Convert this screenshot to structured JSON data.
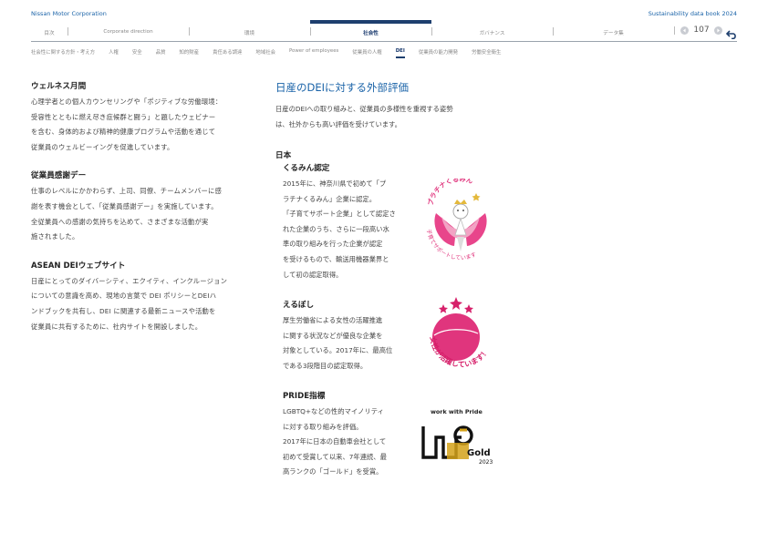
{
  "header": {
    "company": "Nissan Motor Corporation",
    "book": "Sustainability data book 2024"
  },
  "nav": {
    "tabs": [
      "目次",
      "Corporate direction",
      "環境",
      "社会性",
      "ガバナンス",
      "データ集"
    ],
    "active_index": 3,
    "page": "107"
  },
  "subnav": {
    "items": [
      "社会性に関する方針・考え方",
      "人権",
      "安全",
      "品質",
      "知的財産",
      "責任ある調達",
      "地域社会",
      "Power of employees",
      "従業員の人権",
      "DEI",
      "従業員の能力開発",
      "労働安全衛生"
    ],
    "active_index": 9
  },
  "left": {
    "sections": [
      {
        "title": "ウェルネス月間",
        "lines": [
          "心理学者との個人カウンセリングや「ポジティブな労働環境：",
          "受容性とともに燃え尽き症候群と闘う」と題したウェビナー",
          "を含む、身体的および精神的健康プログラムや活動を通じて",
          "従業員のウェルビーイングを促進しています。"
        ]
      },
      {
        "title": "従業員感謝デー",
        "lines": [
          "仕事のレベルにかかわらず、上司、同僚、チームメンバーに感",
          "謝を表す機会として、「従業員感謝デー」を実施しています。",
          "全従業員への感謝の気持ちを込めて、さまざまな活動が実",
          "施されました。"
        ]
      },
      {
        "title": "ASEAN DEIウェブサイト",
        "lines": [
          "日産にとってのダイバーシティ、エクイティ、インクルージョン",
          "についての意識を高め、現地の言葉で DEI ポリシーとDEIハ",
          "ンドブックを共有し、DEI に関連する最新ニュースや活動を",
          "従業員に共有するために、社内サイトを開設しました。"
        ]
      }
    ]
  },
  "right": {
    "title": "日産のDEIに対する外部評価",
    "intro_lines": [
      "日産のDEIへの取り組みと、従業員の多様性を重視する姿勢",
      "は、社外からも高い評価を受けています。"
    ],
    "region": "日本",
    "awards": [
      {
        "title": "くるみん認定",
        "lines": [
          "2015年に、神奈川県で初めて「プ",
          "ラチナくるみん」企業に認定。",
          "「子育てサポート企業」として認定さ",
          "れた企業のうち、さらに一段高い水",
          "準の取り組みを行った企業が認定",
          "を受けるもので、輸送用機器業界と",
          "して初の認定取得。"
        ],
        "logo_text_top": "プラチナくるみん",
        "logo_text_bottom": "子育てサポートしています"
      },
      {
        "title": "えるぼし",
        "lines": [
          "厚生労働省による女性の活躍推進",
          "に関する状況などが優良な企業を",
          "対象としている。2017年に、最高位",
          "である3段階目の認定取得。"
        ],
        "logo_text": "女性が活躍しています！"
      },
      {
        "title": "PRIDE指標",
        "lines": [
          "LGBTQ+などの性的マイノリティ",
          "に対する取り組みを評価。",
          "2017年に日本の自動車会社として",
          "初めて受賞して以来、7年連続、最",
          "高ランクの「ゴールド」を受賞。"
        ],
        "logo_top": "work with Pride",
        "logo_grade": "Gold",
        "logo_year": "2023"
      }
    ]
  },
  "colors": {
    "accent_blue": "#1a63a8",
    "navy": "#1e3f6e",
    "kurumin_pink": "#e0357d",
    "gold": "#d4a21a"
  }
}
